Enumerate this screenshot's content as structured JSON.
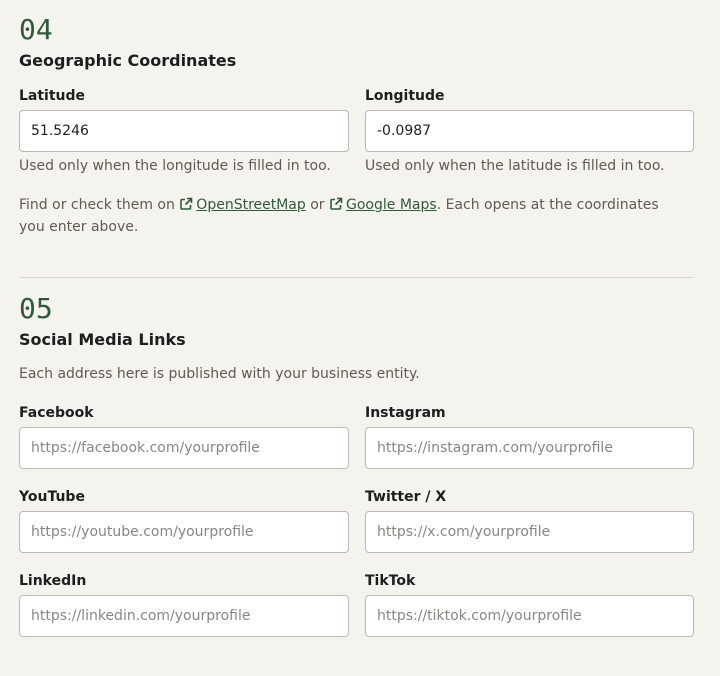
{
  "coords": {
    "number": "04",
    "title": "Geographic Coordinates",
    "latitude": {
      "label": "Latitude",
      "value": "51.5246",
      "help": "Used only when the longitude is filled in too."
    },
    "longitude": {
      "label": "Longitude",
      "value": "-0.0987",
      "help": "Used only when the latitude is filled in too."
    },
    "finder": {
      "prefix": "Find or check them on ",
      "link1": "OpenStreetMap",
      "middle": " or ",
      "link2": "Google Maps",
      "suffix": ". Each opens at the coordinates",
      "line2": "you enter above."
    },
    "icons": {
      "external_link": "external-link-icon"
    }
  },
  "social": {
    "number": "05",
    "title": "Social Media Links",
    "description": "Each address here is published with your business entity.",
    "fields": [
      {
        "label": "Facebook",
        "placeholder": "https://facebook.com/yourprofile",
        "value": ""
      },
      {
        "label": "Instagram",
        "placeholder": "https://instagram.com/yourprofile",
        "value": ""
      },
      {
        "label": "YouTube",
        "placeholder": "https://youtube.com/yourprofile",
        "value": ""
      },
      {
        "label": "Twitter / X",
        "placeholder": "https://x.com/yourprofile",
        "value": ""
      },
      {
        "label": "LinkedIn",
        "placeholder": "https://linkedin.com/yourprofile",
        "value": ""
      },
      {
        "label": "TikTok",
        "placeholder": "https://tiktok.com/yourprofile",
        "value": ""
      }
    ]
  },
  "colors": {
    "background": "#f5f3ee",
    "accent": "#2f5a3a",
    "border": "#bdb9b1",
    "muted_text": "#5f5a53"
  }
}
